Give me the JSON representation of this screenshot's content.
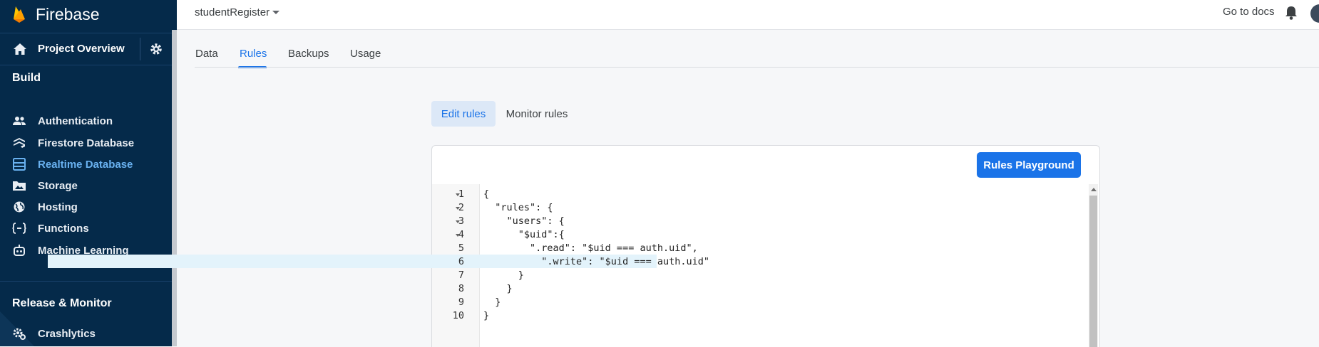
{
  "sidebar": {
    "brand": "Firebase",
    "project_overview": "Project Overview",
    "build_heading": "Build",
    "build_items": [
      {
        "label": "Authentication",
        "icon": "users-icon"
      },
      {
        "label": "Firestore Database",
        "icon": "firestore-icon"
      },
      {
        "label": "Realtime Database",
        "icon": "database-icon",
        "active": true
      },
      {
        "label": "Storage",
        "icon": "image-icon"
      },
      {
        "label": "Hosting",
        "icon": "globe-icon"
      },
      {
        "label": "Functions",
        "icon": "functions-icon"
      },
      {
        "label": "Machine Learning",
        "icon": "robot-icon"
      }
    ],
    "release_heading": "Release & Monitor",
    "release_items": [
      {
        "label": "Crashlytics",
        "icon": "crashlytics-icon"
      }
    ]
  },
  "topbar": {
    "project_name": "studentRegister",
    "go_to_docs": "Go to docs"
  },
  "tabs": [
    "Data",
    "Rules",
    "Backups",
    "Usage"
  ],
  "active_tab": "Rules",
  "rule_tabs": [
    "Edit rules",
    "Monitor rules"
  ],
  "active_rule_tab": "Edit rules",
  "editor": {
    "playground_button": "Rules Playground",
    "line_numbers": [
      "1",
      "2",
      "3",
      "4",
      "5",
      "6",
      "7",
      "8",
      "9",
      "10"
    ],
    "lines": [
      "{",
      "  \"rules\": {",
      "    \"users\": {",
      "      \"$uid\":{",
      "        \".read\": \"$uid === auth.uid\",",
      "          \".write\": \"$uid === auth.uid\"",
      "      }",
      "    }",
      "  }",
      "}"
    ],
    "highlighted_line": 6
  },
  "colors": {
    "sidebar_bg": "#052a4a",
    "accent": "#1a73e8",
    "active_nav": "#69b1f0",
    "firebase_orange": "#ffa000"
  }
}
